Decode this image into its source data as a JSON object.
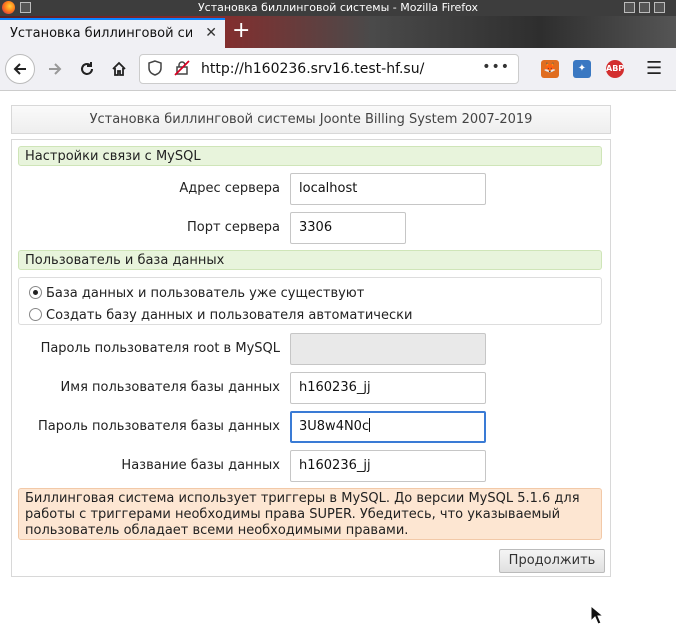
{
  "window": {
    "title": "Установка биллинговой системы - Mozilla Firefox"
  },
  "tab": {
    "label": "Установка биллинговой систе",
    "close": "✕",
    "new_tab": "+"
  },
  "nav": {
    "url": "http://h160236.srv16.test-hf.su/",
    "page_actions": "•••",
    "ext_abp": "ABP",
    "menu": "☰"
  },
  "page": {
    "header": "Установка биллинговой системы Joonte Billing System 2007-2019",
    "section1": "Настройки связи с MySQL",
    "server_address_label": "Адрес сервера",
    "server_address_value": "localhost",
    "server_port_label": "Порт сервера",
    "server_port_value": "3306",
    "section2": "Пользователь и база данных",
    "radio1": "База данных и пользователь уже существуют",
    "radio2": "Создать базу данных и пользователя автоматически",
    "root_password_label": "Пароль пользователя root в MySQL",
    "root_password_value": "",
    "db_user_label": "Имя пользователя базы данных",
    "db_user_value": "h160236_jj",
    "db_password_label": "Пароль пользователя базы данных",
    "db_password_value": "3U8w4N0c",
    "db_name_label": "Название базы данных",
    "db_name_value": "h160236_jj",
    "note": "Биллинговая система использует триггеры в MySQL. До версии MySQL 5.1.6 для работы с триггерами необходимы права SUPER. Убедитесь, что указываемый пользователь обладает всеми необходимыми правами.",
    "continue_button": "Продолжить"
  },
  "radio_selected": "existing"
}
